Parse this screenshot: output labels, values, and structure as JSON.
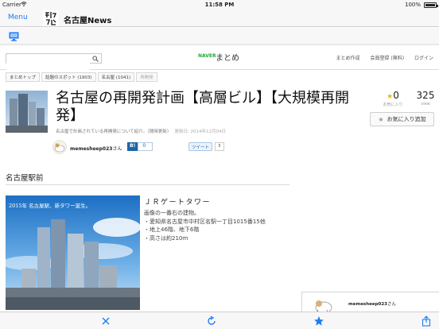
{
  "status": {
    "carrier": "Carrier",
    "time": "11:58 PM",
    "battery_pct": "100%",
    "battery_level": 1.0
  },
  "nav": {
    "menu": "Menu",
    "title": "名古屋News"
  },
  "site": {
    "search_placeholder": "",
    "brand_small": "NAVER",
    "brand": "まとめ",
    "links": [
      "まとめ作成",
      "会員登録 (無料)",
      "ログイン"
    ]
  },
  "breadcrumbs": [
    "まとめトップ",
    "話題のスポット (1903)",
    "名古屋 (1041)",
    "再開発"
  ],
  "article": {
    "title": "名古屋の再開発計画【高層ビル】【大規模再開発】",
    "description": "名古屋で計画されている再開発について紹介。（随時更新）",
    "date": "更新日: 2014年12月04日",
    "author": "memesheep023",
    "author_suffix": "さん",
    "hatena_label": "B!",
    "hatena_count": "0",
    "tweet_label": "ツイート",
    "tweet_count": "3",
    "favorites": "0",
    "favorites_label": "お気に入り",
    "views": "325",
    "views_label": "view",
    "fav_button": "お気に入り追加"
  },
  "section": {
    "title": "名古屋駅前",
    "image_caption": "2015年 名古屋駅、新タワー誕生。",
    "item_title": "ＪＲゲートタワー",
    "item_lines": [
      "画像の一番右の建物。",
      "・愛知県名古屋市中村区名駅一丁目1015番15他",
      "・地上46階、地下6階",
      "・高さは約210ｍ"
    ]
  },
  "float_box": {
    "author": "memesheep023",
    "author_suffix": "さん"
  },
  "colors": {
    "ios_blue": "#1e7bf6",
    "naver_green": "#22aa33",
    "hatena_blue": "#1d65a6",
    "star_gold": "#f0b400"
  },
  "icons": [
    "wifi-icon",
    "battery-icon",
    "monitor-icon",
    "search-icon",
    "close-icon",
    "reload-icon",
    "star-icon",
    "share-icon"
  ]
}
